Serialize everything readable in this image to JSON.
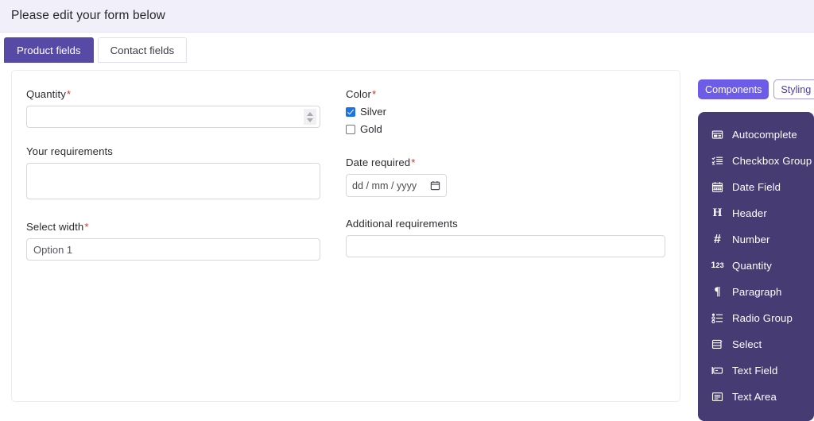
{
  "header": {
    "title": "Please edit your form below"
  },
  "tabs": [
    {
      "label": "Product fields",
      "active": true
    },
    {
      "label": "Contact fields",
      "active": false
    }
  ],
  "form": {
    "left_fields": [
      {
        "name": "quantity",
        "label": "Quantity",
        "required": true,
        "type": "number",
        "value": "",
        "placeholder": ""
      },
      {
        "name": "your-requirements",
        "label": "Your requirements",
        "required": false,
        "type": "textarea",
        "value": "",
        "placeholder": ""
      },
      {
        "name": "select-width",
        "label": "Select width",
        "required": true,
        "type": "select",
        "value": "Option 1"
      }
    ],
    "right_fields": [
      {
        "name": "color",
        "label": "Color",
        "required": true,
        "type": "checkbox-group",
        "options": [
          {
            "label": "Silver",
            "checked": true
          },
          {
            "label": "Gold",
            "checked": false
          }
        ]
      },
      {
        "name": "date-required",
        "label": "Date required",
        "required": true,
        "type": "date",
        "value": "dd / mm / yyyy"
      },
      {
        "name": "additional-requirements",
        "label": "Additional requirements",
        "required": false,
        "type": "text",
        "value": "",
        "placeholder": ""
      }
    ],
    "required_marker": "*"
  },
  "right_panel": {
    "toggles": [
      {
        "label": "Components",
        "active": true
      },
      {
        "label": "Styling",
        "active": false
      }
    ],
    "components": [
      {
        "label": "Autocomplete",
        "icon": "autocomplete-icon"
      },
      {
        "label": "Checkbox Group",
        "icon": "checkbox-group-icon"
      },
      {
        "label": "Date Field",
        "icon": "calendar-icon"
      },
      {
        "label": "Header",
        "icon": "header-h-icon"
      },
      {
        "label": "Number",
        "icon": "hash-icon"
      },
      {
        "label": "Quantity",
        "icon": "numeric-123-icon"
      },
      {
        "label": "Paragraph",
        "icon": "pilcrow-icon"
      },
      {
        "label": "Radio Group",
        "icon": "radio-group-icon"
      },
      {
        "label": "Select",
        "icon": "select-icon"
      },
      {
        "label": "Text Field",
        "icon": "text-field-icon"
      },
      {
        "label": "Text Area",
        "icon": "text-area-icon"
      }
    ]
  },
  "colors": {
    "header_bg": "#f1f0fa",
    "active_tab": "#574aa6",
    "panel_bg": "#463b72",
    "toggle_active": "#6c5ce7",
    "required_star": "#d93025",
    "checkbox_checked": "#1a73e8"
  }
}
